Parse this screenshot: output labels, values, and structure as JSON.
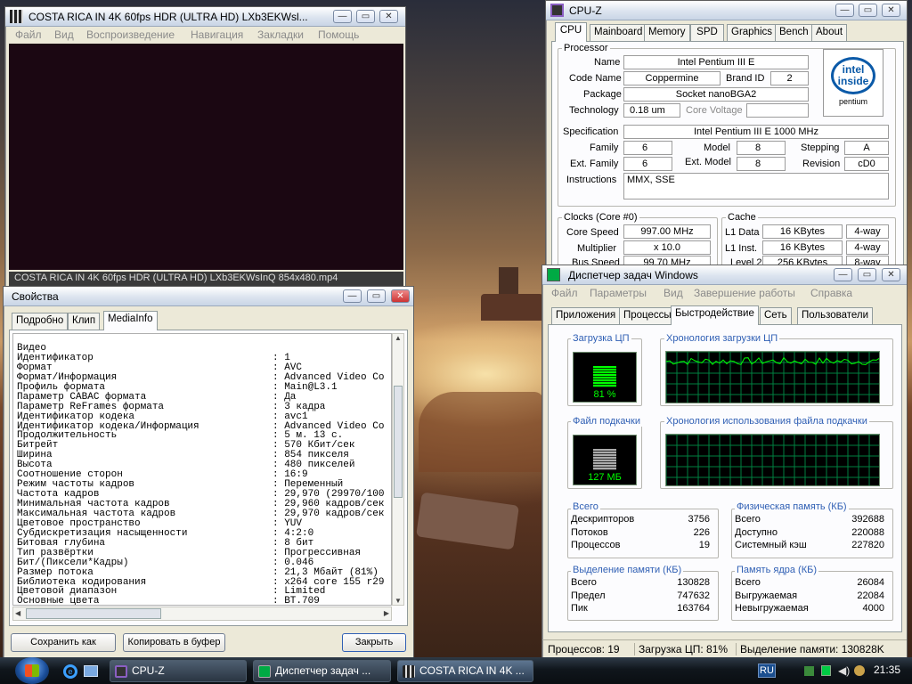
{
  "player": {
    "title": "COSTA RICA IN 4K 60fps HDR (ULTRA HD) LXb3EKWsl...",
    "menu": [
      "Файл",
      "Вид",
      "Воспроизведение",
      "Навигация",
      "Закладки",
      "Помощь"
    ],
    "status": "COSTA RICA IN 4K 60fps HDR (ULTRA HD) LXb3EKWsInQ 854x480.mp4"
  },
  "props": {
    "title": "Свойства",
    "tabs": [
      "Подробно",
      "Клип",
      "MediaInfo"
    ],
    "rows": [
      [
        "Видео",
        ""
      ],
      [
        "Идентификатор",
        "1"
      ],
      [
        "Формат",
        "AVC"
      ],
      [
        "Формат/Информация",
        "Advanced Video Co"
      ],
      [
        "Профиль формата",
        "Main@L3.1"
      ],
      [
        "Параметр CABAC формата",
        "Да"
      ],
      [
        "Параметр ReFrames формата",
        "3 кадра"
      ],
      [
        "Идентификатор кодека",
        "avc1"
      ],
      [
        "Идентификатор кодека/Информация",
        "Advanced Video Co"
      ],
      [
        "Продолжительность",
        "5 м. 13 с."
      ],
      [
        "Битрейт",
        "570 Кбит/сек"
      ],
      [
        "Ширина",
        "854 пикселя"
      ],
      [
        "Высота",
        "480 пикселей"
      ],
      [
        "Соотношение сторон",
        "16:9"
      ],
      [
        "Режим частоты кадров",
        "Переменный"
      ],
      [
        "Частота кадров",
        "29,970 (29970/100"
      ],
      [
        "Минимальная частота кадров",
        "29,960 кадров/сек"
      ],
      [
        "Максимальная частота кадров",
        "29,970 кадров/сек"
      ],
      [
        "Цветовое пространство",
        "YUV"
      ],
      [
        "Субдискретизация насыщенности",
        "4:2:0"
      ],
      [
        "Битовая глубина",
        "8 бит"
      ],
      [
        "Тип развёртки",
        "Прогрессивная"
      ],
      [
        "Бит/(Пиксели*Кадры)",
        "0.046"
      ],
      [
        "Размер потока",
        "21,3 Мбайт (81%)"
      ],
      [
        "Библиотека кодирования",
        "x264 core 155 r29"
      ],
      [
        "Цветовой диапазон",
        "Limited"
      ],
      [
        "Основные цвета",
        "BT.709"
      ]
    ],
    "save_btn": "Сохранить как",
    "copy_btn": "Копировать в буфер",
    "close_btn": "Закрыть"
  },
  "cpuz": {
    "title": "CPU-Z",
    "tabs": [
      "CPU",
      "Mainboard",
      "Memory",
      "SPD",
      "Graphics",
      "Bench",
      "About"
    ],
    "processor_group": "Processor",
    "name_lbl": "Name",
    "name": "Intel Pentium III E",
    "code_lbl": "Code Name",
    "code": "Coppermine",
    "brand_lbl": "Brand ID",
    "brand": "2",
    "pkg_lbl": "Package",
    "pkg": "Socket nanoBGA2",
    "tech_lbl": "Technology",
    "tech": "0.18 um",
    "cv_lbl": "Core Voltage",
    "cv": "",
    "spec_lbl": "Specification",
    "spec": "Intel Pentium III E 1000 MHz",
    "fam_lbl": "Family",
    "fam": "6",
    "model_lbl": "Model",
    "model": "8",
    "step_lbl": "Stepping",
    "step": "A",
    "efam_lbl": "Ext. Family",
    "efam": "6",
    "emodel_lbl": "Ext. Model",
    "emodel": "8",
    "rev_lbl": "Revision",
    "rev": "cD0",
    "instr_lbl": "Instructions",
    "instr": "MMX, SSE",
    "logo_top": "intel",
    "logo_mid": "inside",
    "logo_bot": "pentium",
    "clocks_group": "Clocks (Core #0)",
    "cache_group": "Cache",
    "cs_lbl": "Core Speed",
    "cs": "997.00 MHz",
    "mul_lbl": "Multiplier",
    "mul": "x 10.0",
    "bus_lbl": "Bus Speed",
    "bus": "99.70 MHz",
    "l1d_lbl": "L1 Data",
    "l1d": "16 KBytes",
    "l1d_w": "4-way",
    "l1i_lbl": "L1 Inst.",
    "l1i": "16 KBytes",
    "l1i_w": "4-way",
    "l2_lbl": "Level 2",
    "l2": "256 KBytes",
    "l2_w": "8-way"
  },
  "tm": {
    "title": "Диспетчер задач Windows",
    "menu": [
      "Файл",
      "Параметры",
      "Вид",
      "Завершение работы",
      "Справка"
    ],
    "tabs": [
      "Приложения",
      "Процессы",
      "Быстродействие",
      "Сеть",
      "Пользователи"
    ],
    "cpu_title": "Загрузка ЦП",
    "cpu_value": "81 %",
    "cpu_level": 0.81,
    "cpu_hist_title": "Хронология загрузки ЦП",
    "pf_title": "Файл подкачки",
    "pf_value": "127 МБ",
    "pf_hist_title": "Хронология использования файла подкачки",
    "totals_title": "Всего",
    "totals": [
      [
        "Дескрипторов",
        "3756"
      ],
      [
        "Потоков",
        "226"
      ],
      [
        "Процессов",
        "19"
      ]
    ],
    "phys_title": "Физическая память (КБ)",
    "phys": [
      [
        "Всего",
        "392688"
      ],
      [
        "Доступно",
        "220088"
      ],
      [
        "Системный кэш",
        "227820"
      ]
    ],
    "commit_title": "Выделение памяти (КБ)",
    "commit": [
      [
        "Всего",
        "130828"
      ],
      [
        "Предел",
        "747632"
      ],
      [
        "Пик",
        "163764"
      ]
    ],
    "kernel_title": "Память ядра (КБ)",
    "kernel": [
      [
        "Всего",
        "26084"
      ],
      [
        "Выгружаемая",
        "22084"
      ],
      [
        "Невыгружаемая",
        "4000"
      ]
    ],
    "status": [
      "Процессов: 19",
      "Загрузка ЦП: 81%",
      "Выделение памяти: 130828K"
    ]
  },
  "taskbar": {
    "items": [
      "CPU-Z",
      "Диспетчер задач ...",
      "COSTA RICA IN 4K ..."
    ],
    "lang": "RU",
    "clock": "21:35"
  },
  "colors": {
    "graph_green": "#00ff00",
    "graph_grid": "#008040",
    "meter_green": "#00ff00"
  }
}
